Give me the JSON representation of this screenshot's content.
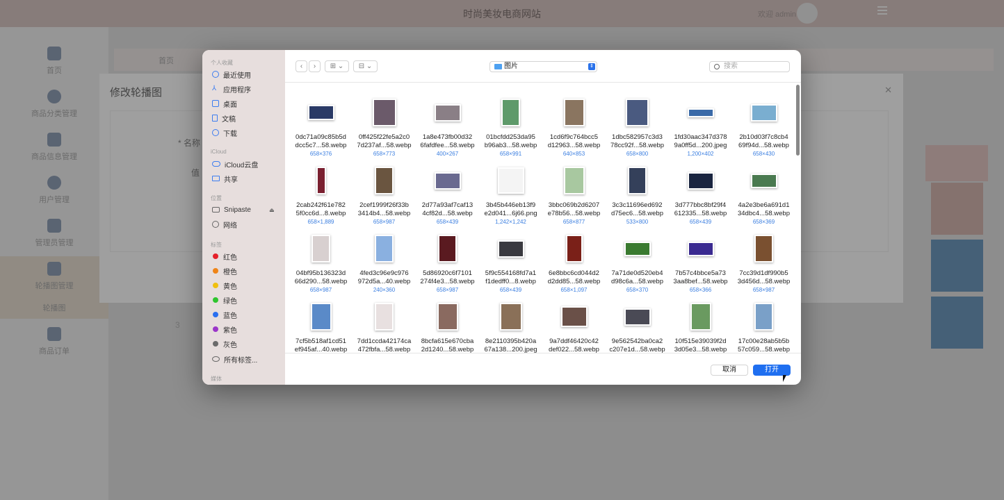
{
  "app": {
    "title": "时尚美妆电商网站",
    "welcome": "欢迎 admin"
  },
  "sidebar": {
    "items": [
      {
        "label": "首页"
      },
      {
        "label": "商品分类管理"
      },
      {
        "label": "用户管理"
      },
      {
        "label": "管理员管理"
      },
      {
        "label": "轮播图管理"
      },
      {
        "label": "商品订单"
      }
    ],
    "sub_item": "轮播图",
    "items_extra": {
      "label": "商品信息管理"
    }
  },
  "breadcrumb": {
    "home": "首页"
  },
  "edit_modal": {
    "title": "修改轮播图",
    "name_label": "* 名称",
    "value_label": "值",
    "pager": "3"
  },
  "file_dialog": {
    "sidebar": {
      "favorites_header": "个人收藏",
      "favorites": [
        "最近使用",
        "应用程序",
        "桌面",
        "文稿",
        "下载"
      ],
      "icloud_header": "iCloud",
      "icloud": [
        "iCloud云盘",
        "共享"
      ],
      "locations_header": "位置",
      "locations": [
        "Snipaste",
        "网络"
      ],
      "tags_header": "标签",
      "tags": [
        {
          "label": "红色",
          "color": "#e5202a"
        },
        {
          "label": "橙色",
          "color": "#ef8418"
        },
        {
          "label": "黄色",
          "color": "#f0c010"
        },
        {
          "label": "绿色",
          "color": "#2fc52e"
        },
        {
          "label": "蓝色",
          "color": "#2a6ff0"
        },
        {
          "label": "紫色",
          "color": "#9b36c9"
        },
        {
          "label": "灰色",
          "color": "#6b6b6b"
        }
      ],
      "all_tags": "所有标签...",
      "media_header": "媒体"
    },
    "toolbar": {
      "back": "‹",
      "forward": "›",
      "view_icon": "⊞ ⌄",
      "group_icon": "⊟ ⌄",
      "location": "图片",
      "search_placeholder": "搜索"
    },
    "files": [
      {
        "name1": "0dc71a09c85b5d",
        "name2": "dcc5c7...58.webp",
        "size": "658×376",
        "color": "#2a3a66"
      },
      {
        "name1": "0ff425f22fe5a2c0",
        "name2": "7d237af...58.webp",
        "size": "658×773",
        "color": "#6b5a6a"
      },
      {
        "name1": "1a8e473fb00d32",
        "name2": "6fafdfee...58.webp",
        "size": "400×267",
        "color": "#8a7f86"
      },
      {
        "name1": "01bcfdd253da95",
        "name2": "b96ab3...58.webp",
        "size": "658×991",
        "color": "#5e9a6a"
      },
      {
        "name1": "1cd6f9c764bcc5",
        "name2": "d12963...58.webp",
        "size": "640×853",
        "color": "#8a7560"
      },
      {
        "name1": "1dbc582957c3d3",
        "name2": "78cc92f...58.webp",
        "size": "658×800",
        "color": "#4a5a80"
      },
      {
        "name1": "1fd30aac347d378",
        "name2": "9a0ff5d...200.jpeg",
        "size": "1,200×402",
        "color": "#3a6aa8"
      },
      {
        "name1": "2b10d03f7c8cb4",
        "name2": "69f94d...58.webp",
        "size": "658×430",
        "color": "#7aaed0"
      },
      {
        "name1": "2cab242f61e782",
        "name2": "5f0cc6d...8.webp",
        "size": "658×1,889",
        "color": "#7a2030"
      },
      {
        "name1": "2cef1999f26f33b",
        "name2": "3414b4...58.webp",
        "size": "658×987",
        "color": "#6a5540"
      },
      {
        "name1": "2d77a93af7caf13",
        "name2": "4cf82d...58.webp",
        "size": "658×439",
        "color": "#6a6a90"
      },
      {
        "name1": "3b45b446eb13f9",
        "name2": "e2d041...6j66.png",
        "size": "1,242×1,242",
        "color": "#f4f4f4"
      },
      {
        "name1": "3bbc069b2d6207",
        "name2": "e78b56...58.webp",
        "size": "658×877",
        "color": "#a8c8a0"
      },
      {
        "name1": "3c3c11696ed692",
        "name2": "d75ec6...58.webp",
        "size": "533×800",
        "color": "#34405a"
      },
      {
        "name1": "3d777bbc8bf29f4",
        "name2": "612335...58.webp",
        "size": "658×439",
        "color": "#1a2540"
      },
      {
        "name1": "4a2e3be6a691d1",
        "name2": "34dbc4...58.webp",
        "size": "658×369",
        "color": "#4a7a50"
      },
      {
        "name1": "04bf95b136323d",
        "name2": "66d290...58.webp",
        "size": "658×987",
        "color": "#d8d0d0"
      },
      {
        "name1": "4fed3c96e9c976",
        "name2": "972d5a...40.webp",
        "size": "240×360",
        "color": "#8ab0e0"
      },
      {
        "name1": "5d86920c6f7101",
        "name2": "274f4e3...58.webp",
        "size": "658×987",
        "color": "#5a1a20"
      },
      {
        "name1": "5f9c554168fd7a1",
        "name2": "f1dedff0...8.webp",
        "size": "658×439",
        "color": "#3a3a40"
      },
      {
        "name1": "6e8bbc6cd044d2",
        "name2": "d2dd85...58.webp",
        "size": "658×1,097",
        "color": "#7a2018"
      },
      {
        "name1": "7a71de0d520eb4",
        "name2": "d98c6a...58.webp",
        "size": "658×370",
        "color": "#3a7a30"
      },
      {
        "name1": "7b57c4bbce5a73",
        "name2": "3aa8bef...58.webp",
        "size": "658×366",
        "color": "#3a2a90"
      },
      {
        "name1": "7cc39d1df990b5",
        "name2": "3d456d...58.webp",
        "size": "658×987",
        "color": "#7a5030"
      },
      {
        "name1": "7cf5b518af1cd51",
        "name2": "ef945af...40.webp",
        "size": "",
        "color": "#5a8ac8"
      },
      {
        "name1": "7dd1ccda42174ca",
        "name2": "472fbfa...58.webp",
        "size": "",
        "color": "#e8e0e0"
      },
      {
        "name1": "8bcfa615e670cba",
        "name2": "2d1240...58.webp",
        "size": "",
        "color": "#8a6a60"
      },
      {
        "name1": "8e2110395b420a",
        "name2": "67a138...200.jpeg",
        "size": "",
        "color": "#8a7058"
      },
      {
        "name1": "9a7ddf46420c42",
        "name2": "def022...58.webp",
        "size": "",
        "color": "#6a5048"
      },
      {
        "name1": "9e562542ba0ca2",
        "name2": "c207e1d...58.webp",
        "size": "",
        "color": "#4a4a55"
      },
      {
        "name1": "10f515e39039f2d",
        "name2": "3d05e3...58.webp",
        "size": "",
        "color": "#6a9a60"
      },
      {
        "name1": "17c00e28ab5b5b",
        "name2": "57c059...58.webp",
        "size": "",
        "color": "#7aa0c8"
      }
    ],
    "footer": {
      "cancel": "取消",
      "open": "打开"
    }
  }
}
